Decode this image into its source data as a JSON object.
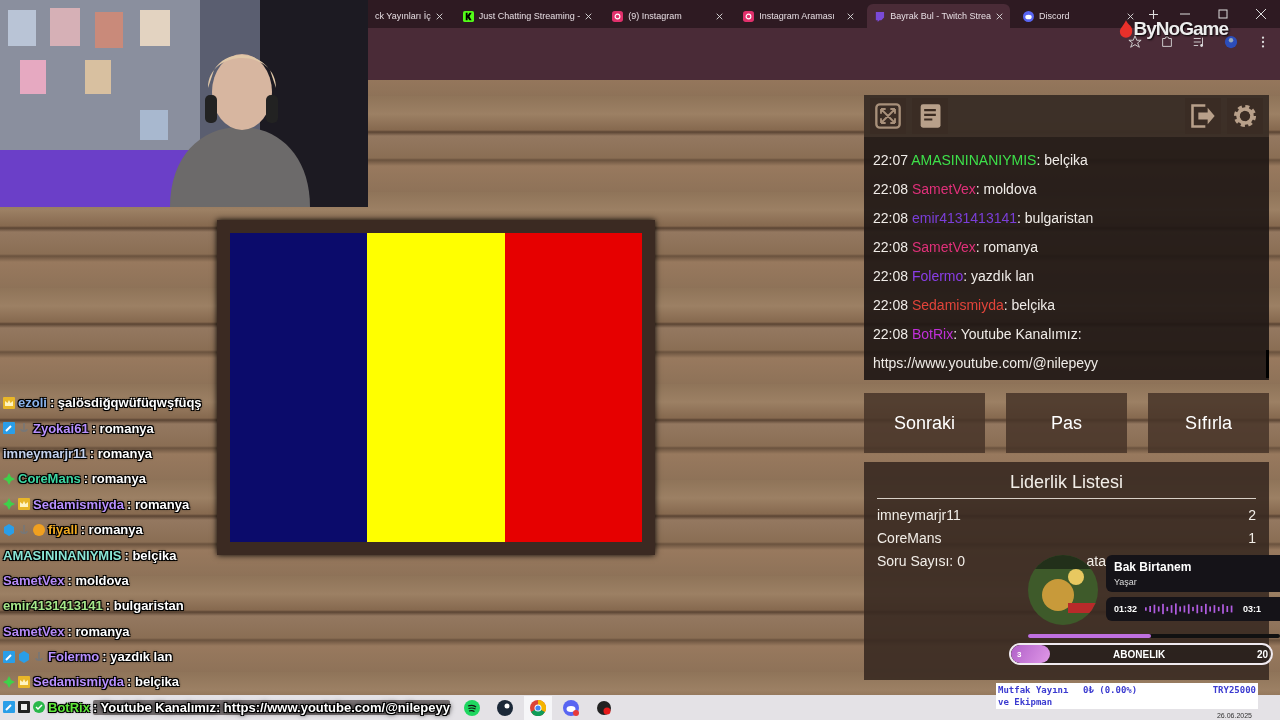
{
  "browser": {
    "tabs": [
      {
        "label": "ck Yayınları İç",
        "kind": "plain",
        "selected": false
      },
      {
        "label": "Just Chatting Streaming -",
        "kind": "kick",
        "selected": false
      },
      {
        "label": "(9) Instagram",
        "kind": "instagram",
        "selected": false
      },
      {
        "label": "Instagram Araması",
        "kind": "instagram",
        "selected": false
      },
      {
        "label": "Bayrak Bul - Twitch Strea",
        "kind": "twitch",
        "selected": true
      },
      {
        "label": "Discord",
        "kind": "discord",
        "selected": false
      }
    ],
    "logo": "ByNoGame"
  },
  "flag": {
    "stripes": [
      {
        "color": "#0b0b6b"
      },
      {
        "color": "#ffff00"
      },
      {
        "color": "#e60000"
      }
    ]
  },
  "chat": [
    {
      "time": "22:07",
      "user": "AMASININANIYMIS",
      "color": "#3ee04a",
      "message": ": belçika"
    },
    {
      "time": "22:08",
      "user": "SametVex",
      "color": "#e0307a",
      "message": ": moldova"
    },
    {
      "time": "22:08",
      "user": "emir4131413141",
      "color": "#7a3ed8",
      "message": ": bulgaristan"
    },
    {
      "time": "22:08",
      "user": "SametVex",
      "color": "#e0307a",
      "message": ": romanya"
    },
    {
      "time": "22:08",
      "user": "Folermo",
      "color": "#8a3ee8",
      "message": ": yazdık lan"
    },
    {
      "time": "22:08",
      "user": "Sedamismiyda",
      "color": "#e2443a",
      "message": ": belçika"
    },
    {
      "time": "22:08",
      "user": "BotRix",
      "color": "#c030d8",
      "message": ": Youtube Kanalımız:",
      "link": "https://www.youtube.com/@nilepeyy"
    }
  ],
  "buttons": [
    "Sonraki",
    "Pas",
    "Sıfırla"
  ],
  "leaderboard": {
    "title": "Liderlik Listesi",
    "rows": [
      {
        "name": "imneymarjr11",
        "score": "2"
      },
      {
        "name": "CoreMans",
        "score": "1"
      }
    ],
    "footer": "Soru Sayısı: 0",
    "obscured_text": "ata"
  },
  "music": {
    "title": "Bak Birtanem",
    "artist": "Yaşar",
    "elapsed": "01:32",
    "duration": "03:1",
    "level": 0.49
  },
  "subscriptions": {
    "current": "3",
    "label": "ABONELIK",
    "goal": "20",
    "level": 0.15
  },
  "donation_goal": {
    "title": "Mutfak Yayını ve Ekipman",
    "amount": "0₺ (0.00%)",
    "goal": "TRY25000"
  },
  "stream_chat": [
    {
      "user": "ezoli",
      "color": "#8ab2ea",
      "badges": [
        {
          "kind": "crown"
        }
      ],
      "message": ": şalösdiğqwüfüqwşfüqş"
    },
    {
      "user": "Zyokai61",
      "color": "#b890ff",
      "badges": [
        {
          "kind": "mod"
        },
        {
          "kind": "hat"
        }
      ],
      "message": ": romanya"
    },
    {
      "user": "imneymarjr11",
      "color": "#c4d2ee",
      "message": ": romanya"
    },
    {
      "user": "CoreMans",
      "color": "#3cd6a2",
      "badges": [
        {
          "kind": "gem"
        }
      ],
      "message": ": romanya"
    },
    {
      "user": "Sedamismiyda",
      "color": "#b890ff",
      "badges": [
        {
          "kind": "gem"
        },
        {
          "kind": "crown"
        }
      ],
      "message": ": romanya"
    },
    {
      "user": "fiyall",
      "color": "#f0aa22",
      "badges": [
        {
          "kind": "cube"
        },
        {
          "kind": "hat"
        },
        {
          "kind": "bits"
        }
      ],
      "message": ": romanya"
    },
    {
      "user": "AMASININANIYMIS",
      "color": "#8ae6d6",
      "message": ": belçika"
    },
    {
      "user": "SametVex",
      "color": "#b58af8",
      "message": ": moldova"
    },
    {
      "user": "emir4131413141",
      "color": "#a6e88a",
      "message": ": bulgaristan"
    },
    {
      "user": "SametVex",
      "color": "#b58af8",
      "message": ": romanya"
    },
    {
      "user": "Folermo",
      "color": "#b890ff",
      "badges": [
        {
          "kind": "mod"
        },
        {
          "kind": "cube"
        },
        {
          "kind": "hat"
        }
      ],
      "message": ": yazdık lan"
    },
    {
      "user": "Sedamismiyda",
      "color": "#b890ff",
      "badges": [
        {
          "kind": "gem"
        },
        {
          "kind": "crown"
        }
      ],
      "message": ": belçika"
    },
    {
      "user": "BotRix",
      "color": "#5ee83a",
      "badges": [
        {
          "kind": "mod"
        },
        {
          "kind": "bot"
        },
        {
          "kind": "verified"
        }
      ],
      "message": ": Youtube Kanalımız: https://www.youtube.com/@nilepeyy"
    }
  ],
  "taskbar": {
    "apps": [
      {
        "kind": "spotify",
        "selected": false
      },
      {
        "kind": "steam",
        "selected": false
      },
      {
        "kind": "chrome",
        "selected": true
      },
      {
        "kind": "discord",
        "selected": false
      },
      {
        "kind": "recorder",
        "selected": false
      }
    ],
    "date": "26.06.2025"
  }
}
